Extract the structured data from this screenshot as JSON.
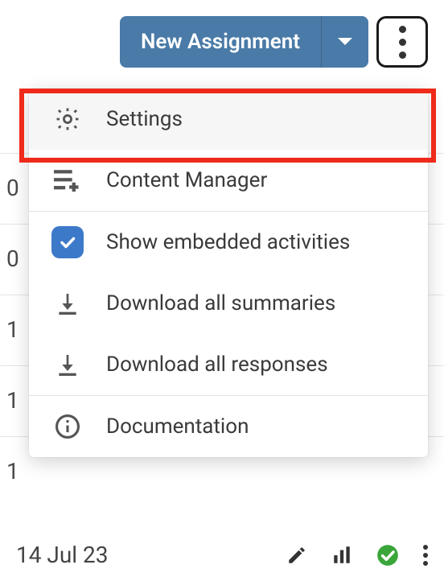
{
  "action_bar": {
    "new_assignment_label": "New Assignment"
  },
  "menu": {
    "settings_label": "Settings",
    "content_manager_label": "Content Manager",
    "show_embedded_label": "Show embedded activities",
    "download_summaries_label": "Download all summaries",
    "download_responses_label": "Download all responses",
    "documentation_label": "Documentation",
    "show_embedded_checked": true
  },
  "side_fragments": [
    "0",
    "0",
    "1",
    "1",
    "1"
  ],
  "bottom": {
    "date_text": "14 Jul 23"
  },
  "colors": {
    "primary": "#4a7aa7",
    "check_badge": "#3d79c9",
    "highlight": "#ef2a1a",
    "success": "#3aa63a"
  }
}
